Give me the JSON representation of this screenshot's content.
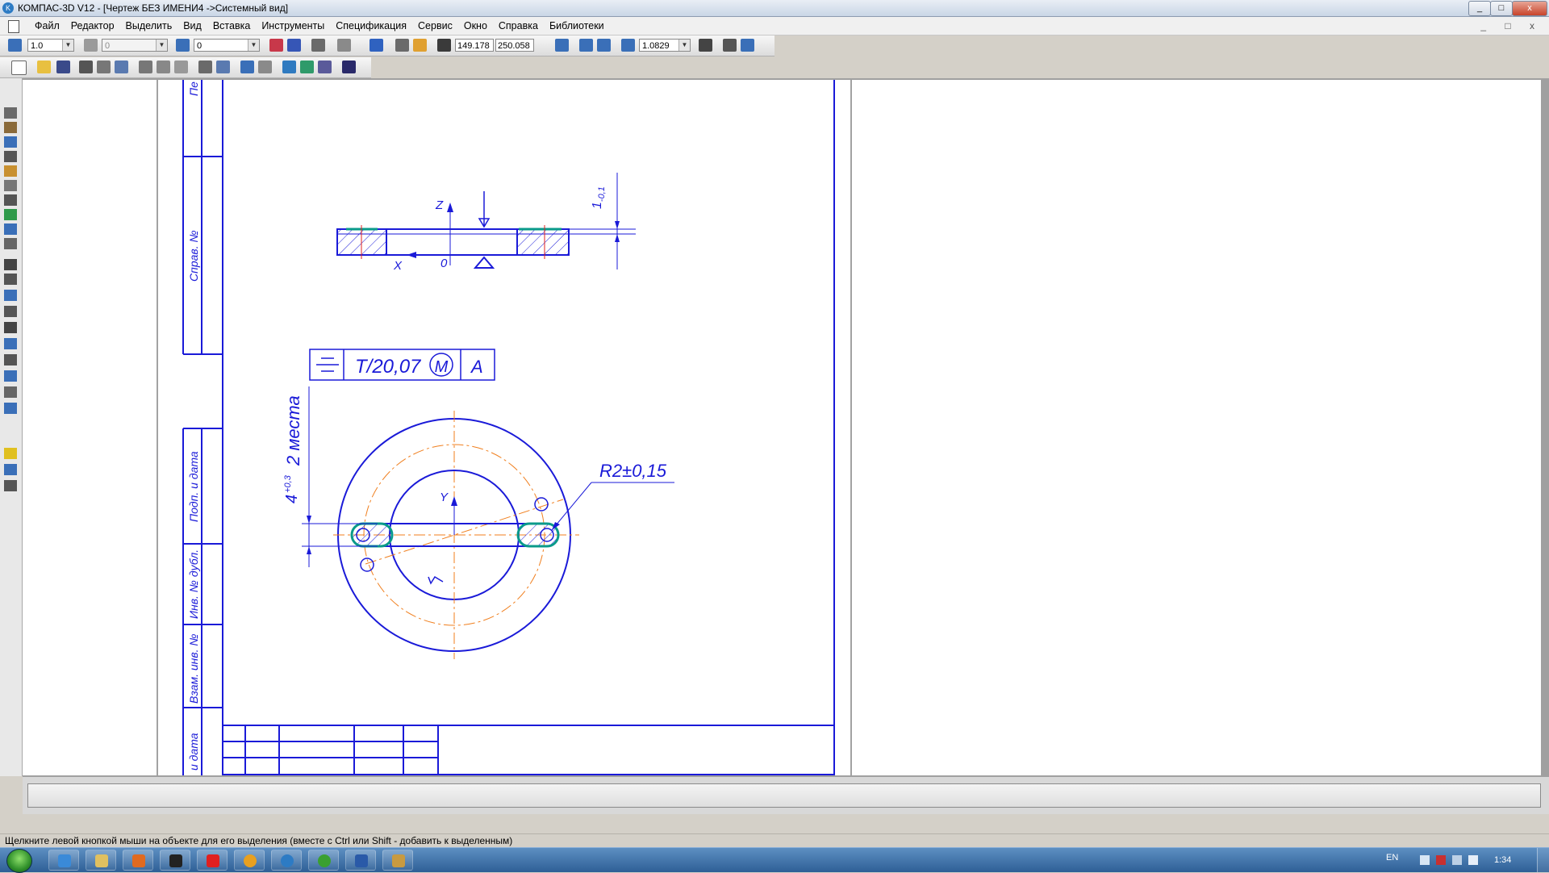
{
  "window": {
    "title": "КОМПАС-3D V12 - [Чертеж БЕЗ ИМЕНИ4 ->Системный вид]",
    "controls": [
      "_",
      "□",
      "x"
    ]
  },
  "menu": {
    "items": [
      "Файл",
      "Редактор",
      "Выделить",
      "Вид",
      "Вставка",
      "Инструменты",
      "Спецификация",
      "Сервис",
      "Окно",
      "Справка",
      "Библиотеки"
    ],
    "mdi_controls": "_ □ x"
  },
  "toolbar": {
    "step": "1.0",
    "style_value": "0",
    "layer_value": "0",
    "coord_x": "149.178",
    "coord_y": "250.058",
    "zoom": "1.0829"
  },
  "drawing": {
    "stamp_labels": {
      "perv": "Пе",
      "sprav": "Справ. №",
      "podp_data": "Подп. и дата",
      "inv_dubl": "Инв. № дубл.",
      "vzam_inv": "Взам. инв. №",
      "i_data": "и дата"
    },
    "top_view": {
      "axis_z": "Z",
      "axis_x": "X",
      "origin": "0",
      "flatness_tol": "1",
      "flatness_sub": "-0,1"
    },
    "tolerance_frame": {
      "symbol": "symmetry",
      "value": "T/20,07",
      "modifier": "M",
      "datum": "A"
    },
    "main_view": {
      "axis_y": "Y",
      "radius_label": "R2±0,15",
      "width_dim": "4",
      "width_tol": "+0,3",
      "places_note": "2 места",
      "mark": "v"
    }
  },
  "status": {
    "hint": "Щелкните левой кнопкой мыши на объекте для его выделения (вместе с Ctrl или Shift - добавить к выделенным)"
  },
  "taskbar": {
    "lang": "EN",
    "clock": "1:34",
    "apps": [
      "ie-icon",
      "explorer-icon",
      "media-icon",
      "app-icon",
      "yandex-icon",
      "chrome-icon",
      "kompas-icon",
      "gear-app-icon",
      "word-icon",
      "kompas-doc-icon"
    ]
  },
  "colors": {
    "geometry": "#1a1ad8",
    "centerline": "#f07f1e",
    "highlight": "#0a9a8a",
    "red": "#e02020"
  }
}
